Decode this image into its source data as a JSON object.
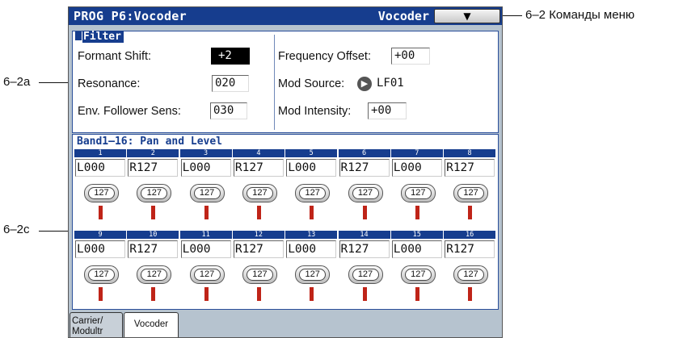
{
  "header": {
    "title": "PROG P6:Vocoder",
    "mode": "Vocoder",
    "menu_glyph": "⌄"
  },
  "callouts": {
    "menu_commands": "6–2 Команды меню",
    "section_a": "6–2a",
    "section_c": "6–2c"
  },
  "filter": {
    "title": "Filter",
    "formant_shift": {
      "label": "Formant Shift:",
      "value": "+2"
    },
    "resonance": {
      "label": "Resonance:",
      "value": "020"
    },
    "env_follower_sens": {
      "label": "Env. Follower Sens:",
      "value": "030"
    },
    "frequency_offset": {
      "label": "Frequency Offset:",
      "value": "+00"
    },
    "mod_source": {
      "label": "Mod Source:",
      "value": "LF01"
    },
    "mod_intensity": {
      "label": "Mod Intensity:",
      "value": "+00"
    }
  },
  "bands": {
    "title": "Band1–16: Pan and Level",
    "items": [
      {
        "num": "1",
        "pan": "L000",
        "level": "127"
      },
      {
        "num": "2",
        "pan": "R127",
        "level": "127"
      },
      {
        "num": "3",
        "pan": "L000",
        "level": "127"
      },
      {
        "num": "4",
        "pan": "R127",
        "level": "127"
      },
      {
        "num": "5",
        "pan": "L000",
        "level": "127"
      },
      {
        "num": "6",
        "pan": "R127",
        "level": "127"
      },
      {
        "num": "7",
        "pan": "L000",
        "level": "127"
      },
      {
        "num": "8",
        "pan": "R127",
        "level": "127"
      },
      {
        "num": "9",
        "pan": "L000",
        "level": "127"
      },
      {
        "num": "10",
        "pan": "R127",
        "level": "127"
      },
      {
        "num": "11",
        "pan": "L000",
        "level": "127"
      },
      {
        "num": "12",
        "pan": "R127",
        "level": "127"
      },
      {
        "num": "13",
        "pan": "L000",
        "level": "127"
      },
      {
        "num": "14",
        "pan": "R127",
        "level": "127"
      },
      {
        "num": "15",
        "pan": "L000",
        "level": "127"
      },
      {
        "num": "16",
        "pan": "R127",
        "level": "127"
      }
    ]
  },
  "tabs": [
    {
      "line1": "Carrier/",
      "line2": "Modultr"
    },
    {
      "label": "Vocoder"
    }
  ],
  "colors": {
    "title_bar": "#163d8e",
    "screen_bg": "#b6c3cf",
    "level_bar": "#bf2418"
  }
}
